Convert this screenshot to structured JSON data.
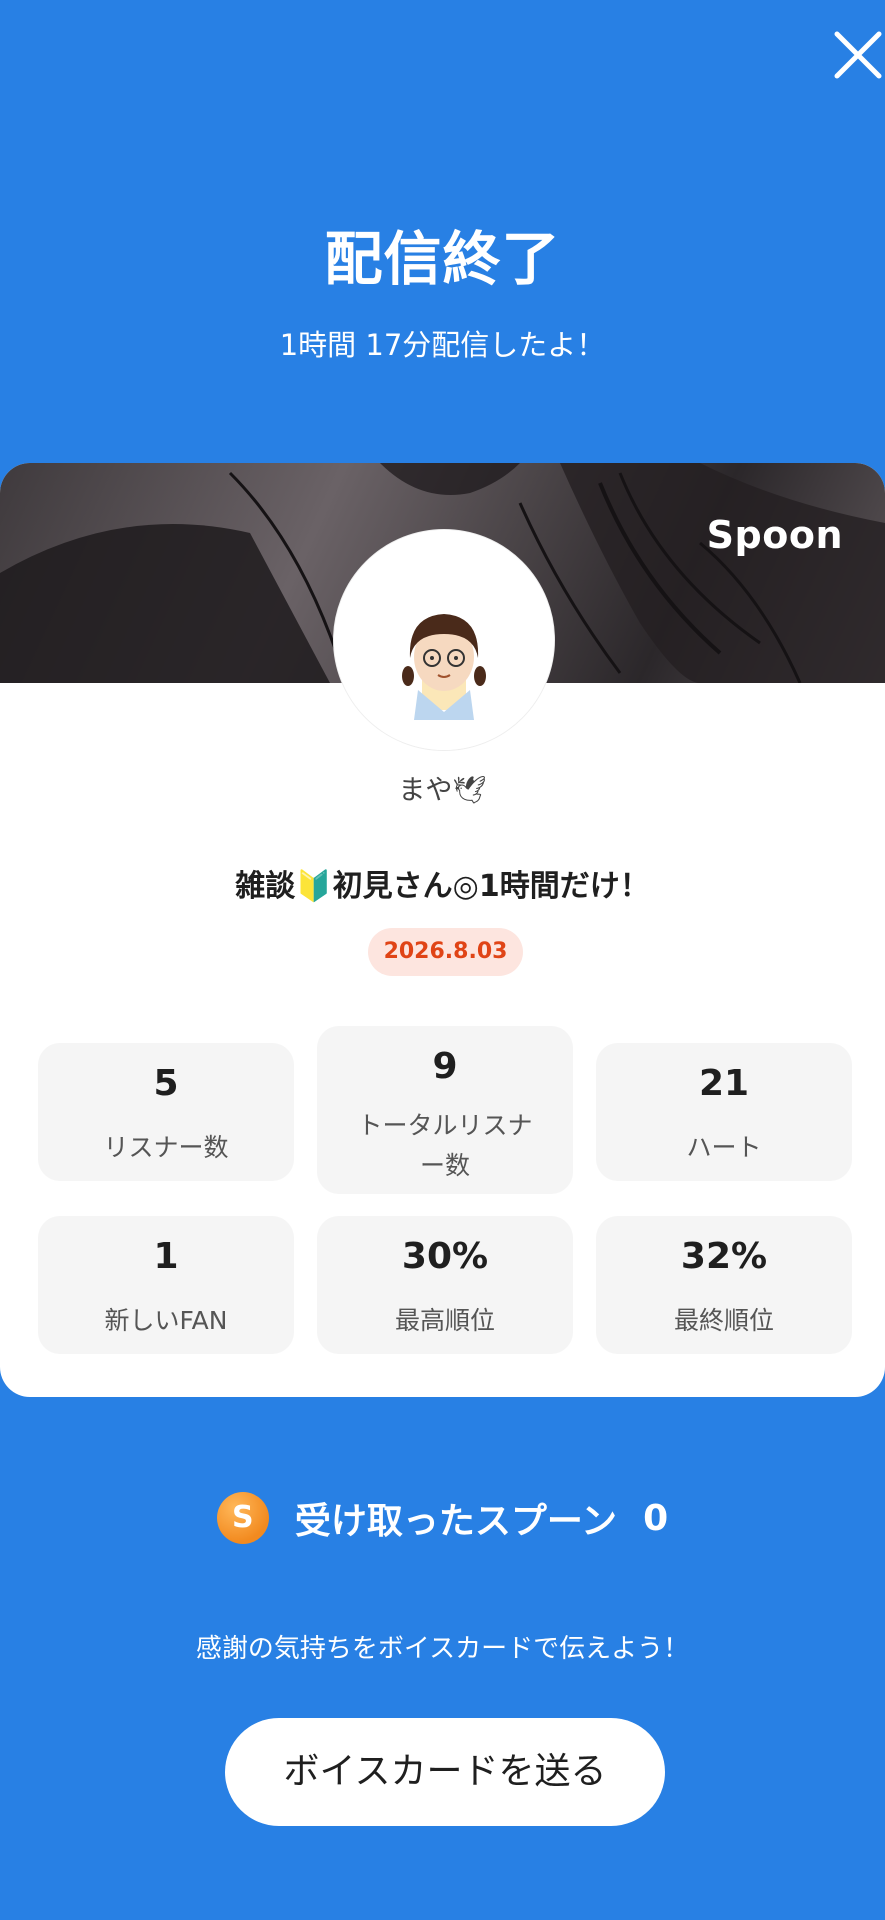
{
  "header": {
    "close_icon": "close-icon",
    "title": "配信終了",
    "subtitle": "1時間 17分配信したよ！"
  },
  "card": {
    "brand": "Spoon",
    "username": "まや🕊",
    "live_title": "雑談🔰初見さん◎1時間だけ！",
    "date": "2026.8.03",
    "stats": [
      {
        "value": "5",
        "label": "リスナー数"
      },
      {
        "value": "9",
        "label": "トータルリスナー数"
      },
      {
        "value": "21",
        "label": "ハート"
      },
      {
        "value": "1",
        "label": "新しいFAN"
      },
      {
        "value": "30%",
        "label": "最高順位"
      },
      {
        "value": "32%",
        "label": "最終順位"
      }
    ]
  },
  "spoons": {
    "icon": "spoon-coin-icon",
    "icon_letter": "S",
    "label": "受け取ったスプーン",
    "count": "0"
  },
  "footer": {
    "thanks_text": "感謝の気持ちをボイスカードで伝えよう！",
    "voice_card_button": "ボイスカードを送る"
  },
  "colors": {
    "background": "#2880e4",
    "card": "#ffffff",
    "date_badge_bg": "#fde5df",
    "date_badge_text": "#e04416",
    "stat_box": "#f5f5f5"
  }
}
